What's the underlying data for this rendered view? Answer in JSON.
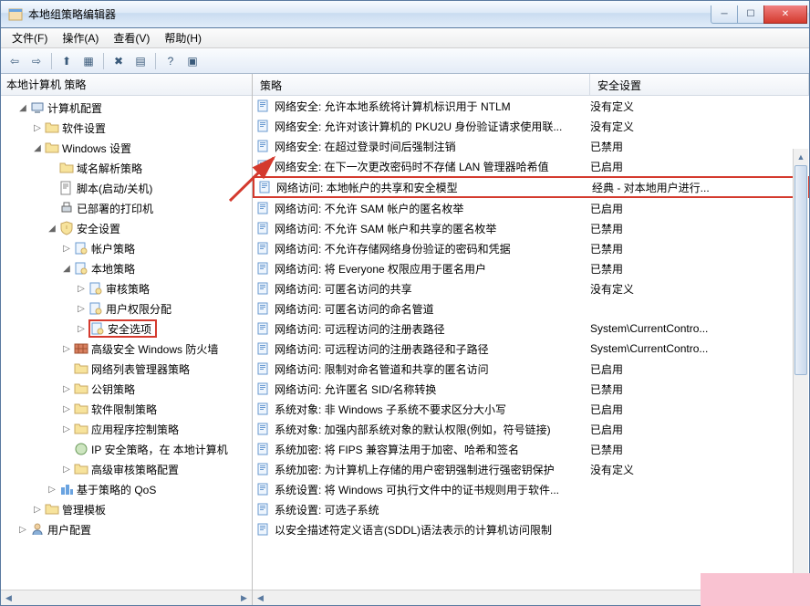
{
  "window": {
    "title": "本地组策略编辑器"
  },
  "menu": {
    "file": "文件(F)",
    "action": "操作(A)",
    "view": "查看(V)",
    "help": "帮助(H)"
  },
  "tree": {
    "header": "本地计算机 策略",
    "root": "计算机配置",
    "items": [
      {
        "label": "软件设置",
        "indent": 2,
        "toggle": "▷",
        "icon": "folder"
      },
      {
        "label": "Windows 设置",
        "indent": 2,
        "toggle": "◢",
        "icon": "folder"
      },
      {
        "label": "域名解析策略",
        "indent": 3,
        "toggle": "",
        "icon": "folder"
      },
      {
        "label": "脚本(启动/关机)",
        "indent": 3,
        "toggle": "",
        "icon": "script"
      },
      {
        "label": "已部署的打印机",
        "indent": 3,
        "toggle": "",
        "icon": "printer"
      },
      {
        "label": "安全设置",
        "indent": 3,
        "toggle": "◢",
        "icon": "security"
      },
      {
        "label": "帐户策略",
        "indent": 4,
        "toggle": "▷",
        "icon": "policy"
      },
      {
        "label": "本地策略",
        "indent": 4,
        "toggle": "◢",
        "icon": "policy"
      },
      {
        "label": "审核策略",
        "indent": 5,
        "toggle": "▷",
        "icon": "policy"
      },
      {
        "label": "用户权限分配",
        "indent": 5,
        "toggle": "▷",
        "icon": "policy"
      },
      {
        "label": "安全选项",
        "indent": 5,
        "toggle": "▷",
        "icon": "policy",
        "hl": true
      },
      {
        "label": "高级安全 Windows 防火墙",
        "indent": 4,
        "toggle": "▷",
        "icon": "firewall"
      },
      {
        "label": "网络列表管理器策略",
        "indent": 4,
        "toggle": "",
        "icon": "folder"
      },
      {
        "label": "公钥策略",
        "indent": 4,
        "toggle": "▷",
        "icon": "folder"
      },
      {
        "label": "软件限制策略",
        "indent": 4,
        "toggle": "▷",
        "icon": "folder"
      },
      {
        "label": "应用程序控制策略",
        "indent": 4,
        "toggle": "▷",
        "icon": "folder"
      },
      {
        "label": "IP 安全策略，在 本地计算机",
        "indent": 4,
        "toggle": "",
        "icon": "ipsec"
      },
      {
        "label": "高级审核策略配置",
        "indent": 4,
        "toggle": "▷",
        "icon": "folder"
      },
      {
        "label": "基于策略的 QoS",
        "indent": 3,
        "toggle": "▷",
        "icon": "qos"
      },
      {
        "label": "管理模板",
        "indent": 2,
        "toggle": "▷",
        "icon": "folder"
      },
      {
        "label": "用户配置",
        "indent": 1,
        "toggle": "▷",
        "icon": "user"
      }
    ]
  },
  "list": {
    "col_policy": "策略",
    "col_setting": "安全设置",
    "rows": [
      {
        "p": "网络安全: 允许本地系统将计算机标识用于 NTLM",
        "s": "没有定义"
      },
      {
        "p": "网络安全: 允许对该计算机的 PKU2U 身份验证请求使用联...",
        "s": "没有定义"
      },
      {
        "p": "网络安全: 在超过登录时间后强制注销",
        "s": "已禁用"
      },
      {
        "p": "网络安全: 在下一次更改密码时不存储 LAN 管理器哈希值",
        "s": "已启用"
      },
      {
        "p": "网络访问: 本地帐户的共享和安全模型",
        "s": "经典 - 对本地用户进行...",
        "hl": true
      },
      {
        "p": "网络访问: 不允许 SAM 帐户的匿名枚举",
        "s": "已启用"
      },
      {
        "p": "网络访问: 不允许 SAM 帐户和共享的匿名枚举",
        "s": "已禁用"
      },
      {
        "p": "网络访问: 不允许存储网络身份验证的密码和凭据",
        "s": "已禁用"
      },
      {
        "p": "网络访问: 将 Everyone 权限应用于匿名用户",
        "s": "已禁用"
      },
      {
        "p": "网络访问: 可匿名访问的共享",
        "s": "没有定义"
      },
      {
        "p": "网络访问: 可匿名访问的命名管道",
        "s": ""
      },
      {
        "p": "网络访问: 可远程访问的注册表路径",
        "s": "System\\CurrentContro..."
      },
      {
        "p": "网络访问: 可远程访问的注册表路径和子路径",
        "s": "System\\CurrentContro..."
      },
      {
        "p": "网络访问: 限制对命名管道和共享的匿名访问",
        "s": "已启用"
      },
      {
        "p": "网络访问: 允许匿名 SID/名称转换",
        "s": "已禁用"
      },
      {
        "p": "系统对象: 非 Windows 子系统不要求区分大小写",
        "s": "已启用"
      },
      {
        "p": "系统对象: 加强内部系统对象的默认权限(例如，符号链接)",
        "s": "已启用"
      },
      {
        "p": "系统加密: 将 FIPS 兼容算法用于加密、哈希和签名",
        "s": "已禁用"
      },
      {
        "p": "系统加密: 为计算机上存储的用户密钥强制进行强密钥保护",
        "s": "没有定义"
      },
      {
        "p": "系统设置: 将 Windows 可执行文件中的证书规则用于软件...",
        "s": ""
      },
      {
        "p": "系统设置: 可选子系统",
        "s": ""
      },
      {
        "p": "以安全描述符定义语言(SDDL)语法表示的计算机访问限制",
        "s": ""
      }
    ]
  }
}
